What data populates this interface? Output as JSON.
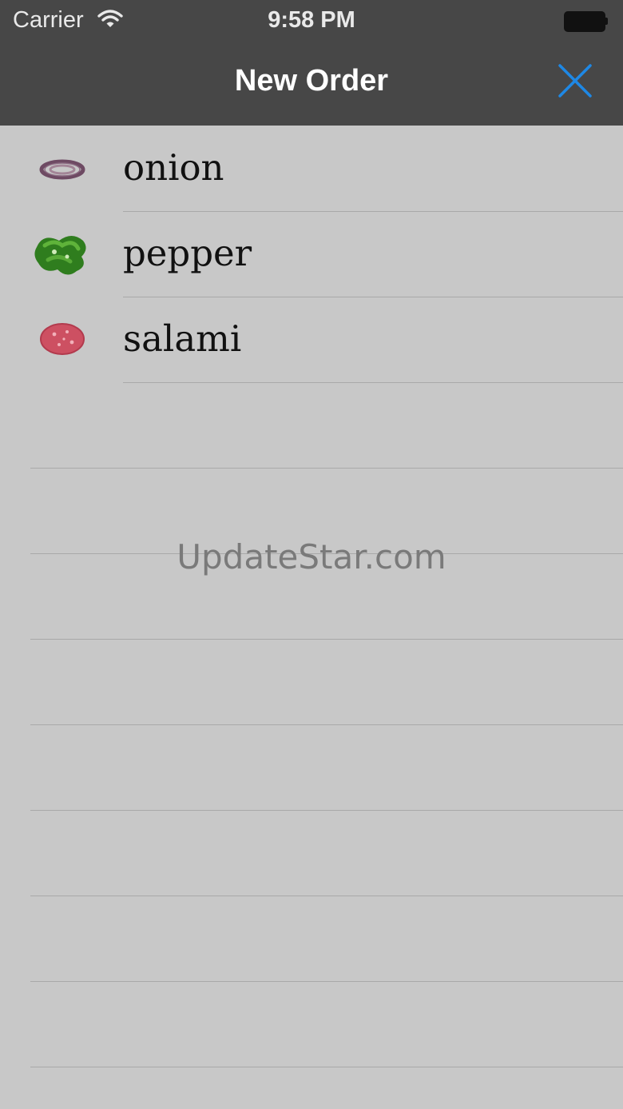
{
  "status_bar": {
    "carrier": "Carrier",
    "time": "9:58 PM"
  },
  "nav": {
    "title": "New Order",
    "close_icon": "close-icon",
    "accent_color": "#1e88e5"
  },
  "items": [
    {
      "label": "onion",
      "icon": "onion-icon"
    },
    {
      "label": "pepper",
      "icon": "pepper-icon"
    },
    {
      "label": "salami",
      "icon": "salami-icon"
    }
  ],
  "watermark": "UpdateStar.com"
}
